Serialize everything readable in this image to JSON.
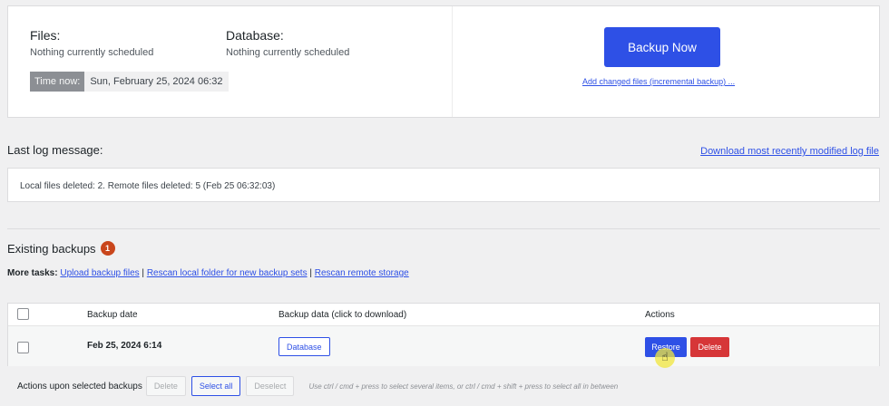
{
  "schedule": {
    "files_title": "Files:",
    "files_status": "Nothing currently scheduled",
    "database_title": "Database:",
    "database_status": "Nothing currently scheduled",
    "time_now_label": "Time now:",
    "time_now_value": "Sun, February 25, 2024 06:32",
    "backup_now_label": "Backup Now",
    "incremental_link": "Add changed files (incremental backup) ..."
  },
  "log": {
    "title": "Last log message:",
    "download_link": "Download most recently modified log file",
    "message": "Local files deleted: 2. Remote files deleted: 5 (Feb 25 06:32:03)"
  },
  "existing": {
    "title": "Existing backups",
    "count": "1",
    "more_tasks_label": "More tasks:",
    "upload_link": "Upload backup files",
    "rescan_local_link": "Rescan local folder for new backup sets",
    "rescan_remote_link": "Rescan remote storage",
    "separator": "|"
  },
  "table": {
    "headers": {
      "date": "Backup date",
      "data": "Backup data (click to download)",
      "actions": "Actions"
    },
    "rows": [
      {
        "date": "Feb 25, 2024 6:14",
        "data_button": "Database",
        "restore_label": "Restore",
        "delete_label": "Delete"
      }
    ]
  },
  "bulk": {
    "label": "Actions upon selected backups",
    "delete_label": "Delete",
    "select_all_label": "Select all",
    "deselect_label": "Deselect",
    "hint": "Use ctrl / cmd + press to select several items, or ctrl / cmd + shift + press to select all in between"
  },
  "colors": {
    "accent": "#2e50e6",
    "danger": "#d63638",
    "badge": "#c9461c",
    "cursor_highlight": "#f0e63c"
  }
}
